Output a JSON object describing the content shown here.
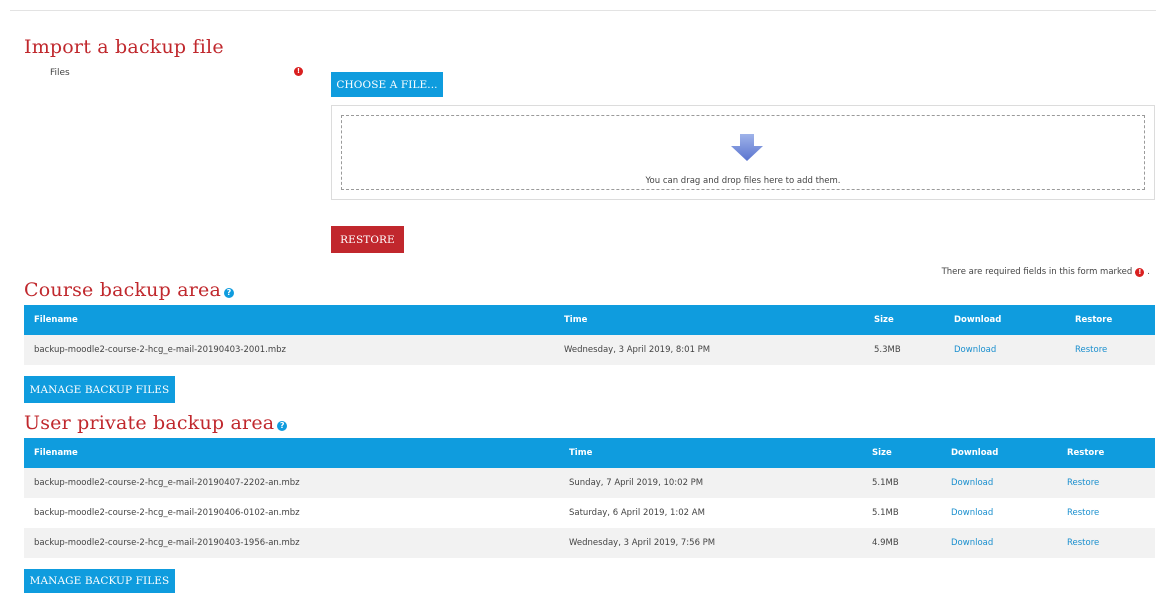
{
  "import": {
    "heading": "Import a backup file",
    "files_label": "Files",
    "choose_button": "CHOOSE A FILE...",
    "drop_text": "You can drag and drop files here to add them.",
    "restore_button": "RESTORE",
    "required_note": "There are required fields in this form marked"
  },
  "course_area": {
    "heading": "Course backup area",
    "columns": [
      "Filename",
      "Time",
      "Size",
      "Download",
      "Restore"
    ],
    "rows": [
      {
        "filename": "backup-moodle2-course-2-hcg_e-mail-20190403-2001.mbz",
        "time": "Wednesday, 3 April 2019, 8:01 PM",
        "size": "5.3MB",
        "download": "Download",
        "restore": "Restore"
      }
    ],
    "manage_button": "MANAGE BACKUP FILES"
  },
  "user_area": {
    "heading": "User private backup area",
    "columns": [
      "Filename",
      "Time",
      "Size",
      "Download",
      "Restore"
    ],
    "rows": [
      {
        "filename": "backup-moodle2-course-2-hcg_e-mail-20190407-2202-an.mbz",
        "time": "Sunday, 7 April 2019, 10:02 PM",
        "size": "5.1MB",
        "download": "Download",
        "restore": "Restore"
      },
      {
        "filename": "backup-moodle2-course-2-hcg_e-mail-20190406-0102-an.mbz",
        "time": "Saturday, 6 April 2019, 1:02 AM",
        "size": "5.1MB",
        "download": "Download",
        "restore": "Restore"
      },
      {
        "filename": "backup-moodle2-course-2-hcg_e-mail-20190403-1956-an.mbz",
        "time": "Wednesday, 3 April 2019, 7:56 PM",
        "size": "4.9MB",
        "download": "Download",
        "restore": "Restore"
      }
    ],
    "manage_button": "MANAGE BACKUP FILES"
  },
  "icons": {
    "required": "exclamation-circle-icon",
    "help": "question-circle-icon",
    "drop": "arrow-down-icon"
  },
  "colors": {
    "heading": "#c0282d",
    "primary": "#0f9cde",
    "danger": "#c1272d",
    "link": "#1a8fce"
  }
}
